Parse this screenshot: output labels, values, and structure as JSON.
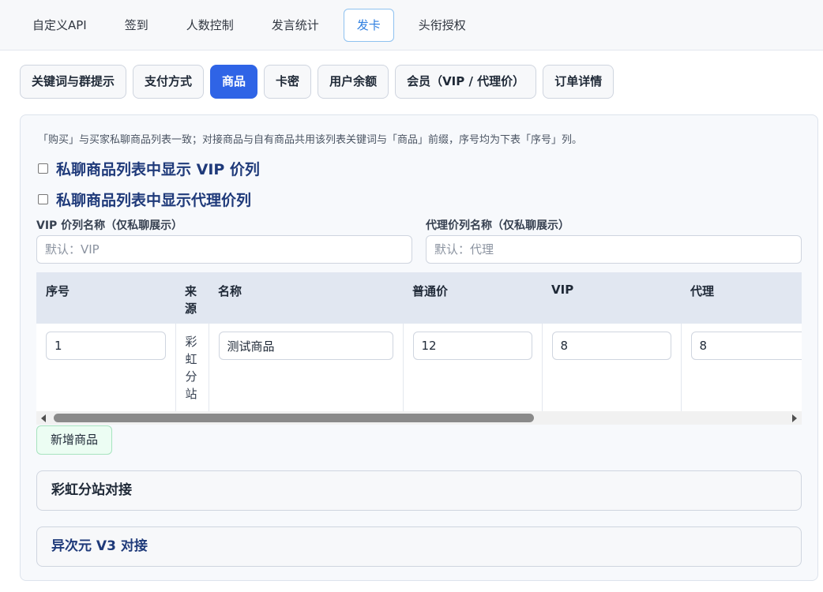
{
  "top_tabs": [
    {
      "label": "自定义API"
    },
    {
      "label": "签到"
    },
    {
      "label": "人数控制"
    },
    {
      "label": "发言统计"
    },
    {
      "label": "发卡"
    },
    {
      "label": "头衔授权"
    }
  ],
  "top_tabs_active": "发卡",
  "sub_tabs": [
    {
      "label": "关键词与群提示"
    },
    {
      "label": "支付方式"
    },
    {
      "label": "商品"
    },
    {
      "label": "卡密"
    },
    {
      "label": "用户余额"
    },
    {
      "label": "会员（VIP / 代理价）"
    },
    {
      "label": "订单详情"
    }
  ],
  "sub_tabs_active": "商品",
  "panel": {
    "note": "「购买」与买家私聊商品列表一致；对接商品与自有商品共用该列表关键词与「商品」前缀，序号均为下表「序号」列。",
    "checkbox_vip": {
      "label": "私聊商品列表中显示 VIP 价列",
      "checked": false
    },
    "checkbox_agent": {
      "label": "私聊商品列表中显示代理价列",
      "checked": false
    },
    "vip_name": {
      "label": "VIP 价列名称（仅私聊展示）",
      "placeholder": "默认：VIP",
      "value": ""
    },
    "agent_name": {
      "label": "代理价列名称（仅私聊展示）",
      "placeholder": "默认：代理",
      "value": ""
    },
    "table": {
      "headers": {
        "index": "序号",
        "source": "来源",
        "name": "名称",
        "price": "普通价",
        "vip": "VIP",
        "agent": "代理"
      },
      "rows": [
        {
          "index": "1",
          "source": "彩虹分站",
          "name": "测试商品",
          "price": "12",
          "vip": "8",
          "agent": "8"
        }
      ]
    },
    "add_button": "新增商品",
    "sections": [
      {
        "label": "彩虹分站对接",
        "color": "#1f2937"
      },
      {
        "label": "异次元 V3 对接",
        "color": "#1f3a7a"
      }
    ]
  },
  "colors": {
    "accent": "#2f64e6",
    "active_tab_text": "#2f7fe0",
    "heading_blue": "#1f3a7a",
    "add_button_bg": "#ecfdf3"
  }
}
